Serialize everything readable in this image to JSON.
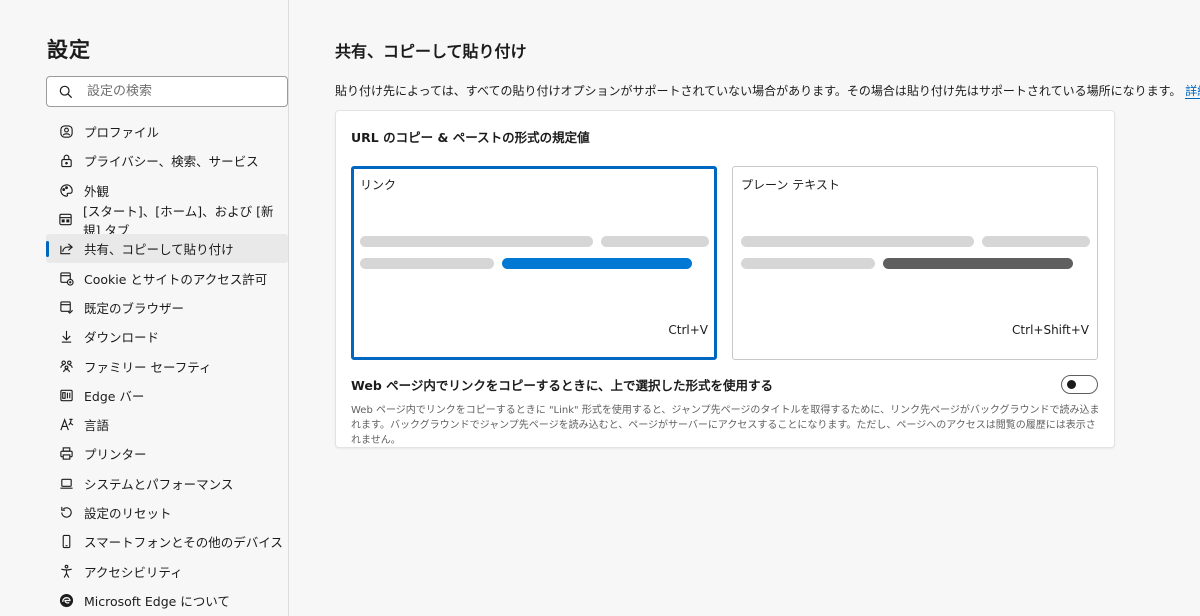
{
  "sidebar": {
    "title": "設定",
    "search_placeholder": "設定の検索",
    "items": [
      {
        "label": "プロファイル",
        "icon": "profile-icon"
      },
      {
        "label": "プライバシー、検索、サービス",
        "icon": "lock-icon"
      },
      {
        "label": "外観",
        "icon": "palette-icon"
      },
      {
        "label": "[スタート]、[ホーム]、および [新規] タブ",
        "icon": "tabs-icon"
      },
      {
        "label": "共有、コピーして貼り付け",
        "icon": "share-icon",
        "active": true
      },
      {
        "label": "Cookie とサイトのアクセス許可",
        "icon": "cookie-icon"
      },
      {
        "label": "既定のブラウザー",
        "icon": "browser-icon"
      },
      {
        "label": "ダウンロード",
        "icon": "download-icon"
      },
      {
        "label": "ファミリー セーフティ",
        "icon": "family-icon"
      },
      {
        "label": "Edge バー",
        "icon": "edge-bar-icon"
      },
      {
        "label": "言語",
        "icon": "language-icon"
      },
      {
        "label": "プリンター",
        "icon": "printer-icon"
      },
      {
        "label": "システムとパフォーマンス",
        "icon": "laptop-icon"
      },
      {
        "label": "設定のリセット",
        "icon": "reset-icon"
      },
      {
        "label": "スマートフォンとその他のデバイス",
        "icon": "phone-icon"
      },
      {
        "label": "アクセシビリティ",
        "icon": "accessibility-icon"
      },
      {
        "label": "Microsoft Edge について",
        "icon": "edge-logo-icon"
      }
    ]
  },
  "main": {
    "title": "共有、コピーして貼り付け",
    "description": "貼り付け先によっては、すべての貼り付けオプションがサポートされていない場合があります。その場合は貼り付け先はサポートされている場所になります。",
    "details_link": "詳細情報",
    "card": {
      "title": "URL のコピー & ペーストの形式の規定値",
      "options": [
        {
          "label": "リンク",
          "shortcut": "Ctrl+V",
          "selected": true
        },
        {
          "label": "プレーン テキスト",
          "shortcut": "Ctrl+Shift+V",
          "selected": false
        }
      ],
      "toggle_label": "Web ページ内でリンクをコピーするときに、上で選択した形式を使用する",
      "toggle_on": false,
      "toggle_description": "Web ページ内でリンクをコピーするときに \"Link\" 形式を使用すると、ジャンプ先ページのタイトルを取得するために、リンク先ページがバックグラウンドで読み込まれます。バックグラウンドでジャンプ先ページを読み込むと、ページがサーバーにアクセスすることになります。ただし、ページへのアクセスは閲覧の履歴には表示されません。"
    }
  },
  "colors": {
    "accent": "#0067c0",
    "link_bar": "#0078d4",
    "plain_bar": "#5f5f5f"
  }
}
